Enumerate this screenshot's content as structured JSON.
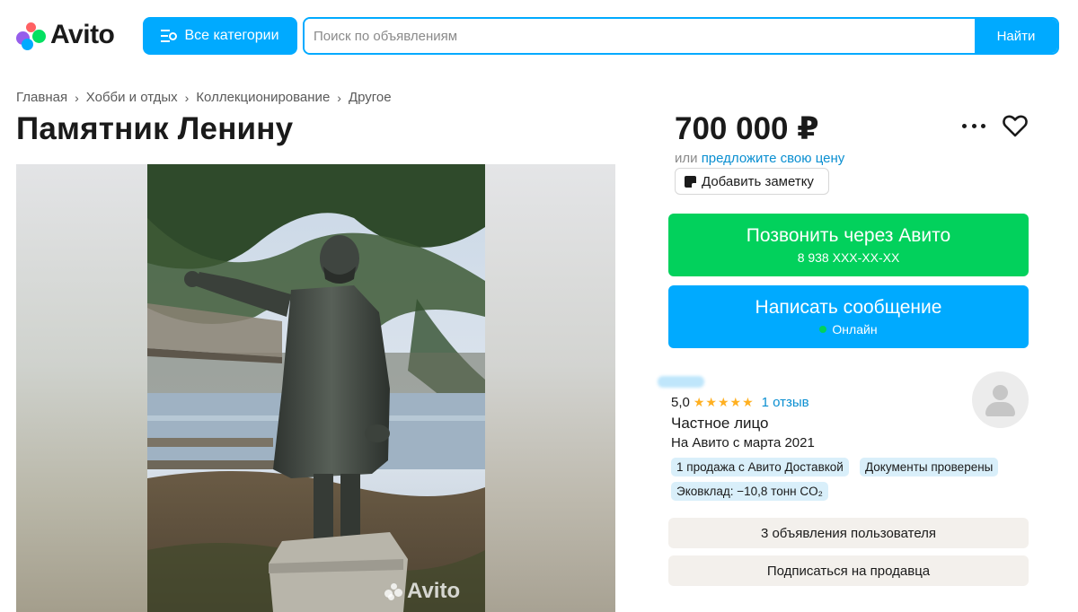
{
  "header": {
    "logo_text": "Avito",
    "categories_label": "Все категории",
    "search_placeholder": "Поиск по объявлениям",
    "search_value": "",
    "search_button": "Найти"
  },
  "breadcrumb": [
    "Главная",
    "Хобби и отдых",
    "Коллекционирование",
    "Другое"
  ],
  "listing": {
    "title": "Памятник Ленину",
    "price": "700 000 ₽",
    "offer_prefix": "или",
    "offer_link": "предложите свою цену",
    "note_button": "Добавить заметку",
    "watermark": "Avito"
  },
  "contact": {
    "call_label": "Позвонить через Авито",
    "call_phone": "8 938 XXX-XX-XX",
    "message_label": "Написать сообщение",
    "message_status": "Онлайн"
  },
  "seller": {
    "rating": "5,0",
    "stars": "★★★★★",
    "star_count": 5,
    "reviews": "1 отзыв",
    "type": "Частное лицо",
    "since": "На Авито с марта 2021",
    "badges": [
      "1 продажа с Авито Доставкой",
      "Документы проверены",
      "Эковклад: −10,8 тонн CO₂"
    ],
    "listings_button": "3 объявления пользователя",
    "subscribe_button": "Подписаться на продавца"
  },
  "colors": {
    "accent_blue": "#00aaff",
    "call_green": "#02d15c",
    "star_gold": "#ffb021",
    "link_blue": "#0a8fd1"
  }
}
